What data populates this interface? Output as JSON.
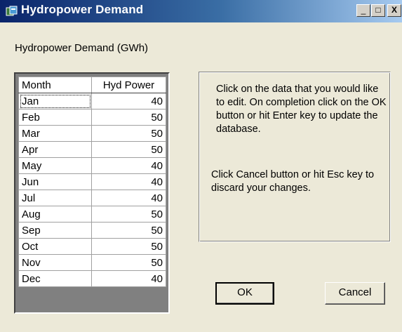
{
  "window": {
    "title": "Hydropower Demand",
    "controls": {
      "minimize": "_",
      "maximize": "□",
      "close": "X"
    }
  },
  "caption": "Hydropower Demand (GWh)",
  "grid": {
    "headers": {
      "month": "Month",
      "power": "Hyd Power"
    },
    "rows": [
      {
        "month": "Jan",
        "power": "40"
      },
      {
        "month": "Feb",
        "power": "50"
      },
      {
        "month": "Mar",
        "power": "50"
      },
      {
        "month": "Apr",
        "power": "50"
      },
      {
        "month": "May",
        "power": "40"
      },
      {
        "month": "Jun",
        "power": "40"
      },
      {
        "month": "Jul",
        "power": "40"
      },
      {
        "month": "Aug",
        "power": "50"
      },
      {
        "month": "Sep",
        "power": "50"
      },
      {
        "month": "Oct",
        "power": "50"
      },
      {
        "month": "Nov",
        "power": "50"
      },
      {
        "month": "Dec",
        "power": "40"
      }
    ]
  },
  "info": {
    "edit_instructions": "Click on the data that you would like to edit. On completion click on the OK button or hit Enter key to update the database.",
    "cancel_instructions": "Click Cancel button or hit Esc key to discard your changes."
  },
  "buttons": {
    "ok": "OK",
    "cancel": "Cancel"
  },
  "colors": {
    "titlebar_start": "#0a246a",
    "titlebar_end": "#a6caf0",
    "face": "#ece9d8"
  }
}
